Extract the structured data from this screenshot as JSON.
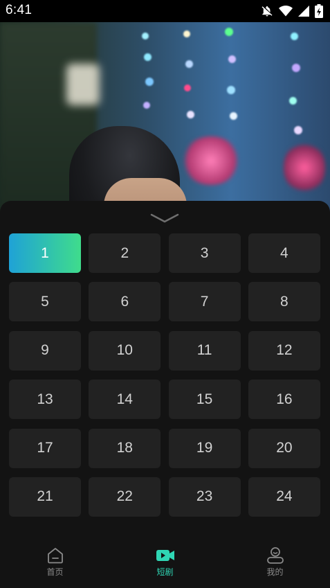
{
  "status_bar": {
    "time": "6:41",
    "icons": [
      "notifications-off-icon",
      "wifi-icon",
      "signal-icon",
      "battery-charging-icon"
    ]
  },
  "colors": {
    "sheet_bg": "#131313",
    "tile_bg": "#222222",
    "active_gradient_start": "#1fa2d6",
    "active_gradient_end": "#3fdc8c",
    "nav_active": "#2fd6b4",
    "nav_inactive": "#8a8a8a"
  },
  "episode_sheet": {
    "collapse_icon": "chevron-down-icon",
    "selected_episode": "1",
    "episodes": [
      "1",
      "2",
      "3",
      "4",
      "5",
      "6",
      "7",
      "8",
      "9",
      "10",
      "11",
      "12",
      "13",
      "14",
      "15",
      "16",
      "17",
      "18",
      "19",
      "20",
      "21",
      "22",
      "23",
      "24"
    ]
  },
  "bottom_nav": {
    "items": [
      {
        "label": "首页",
        "icon": "home-icon",
        "active": false
      },
      {
        "label": "短剧",
        "icon": "video-camera-icon",
        "active": true
      },
      {
        "label": "我的",
        "icon": "profile-icon",
        "active": false
      }
    ]
  }
}
